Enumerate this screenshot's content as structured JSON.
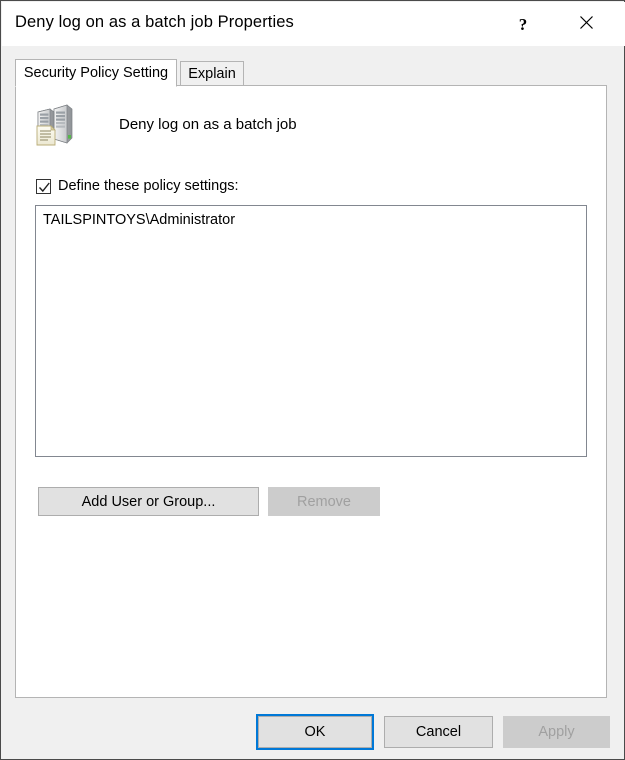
{
  "window": {
    "title": "Deny log on as a batch job Properties",
    "help_label": "?",
    "close_label": "✕"
  },
  "tabs": [
    {
      "label": "Security Policy Setting",
      "active": true
    },
    {
      "label": "Explain",
      "active": false
    }
  ],
  "content": {
    "policy_icon": "server-policy-icon",
    "policy_name": "Deny log on as a batch job",
    "define_checkbox": {
      "label": "Define these policy settings:",
      "checked": true
    },
    "list": {
      "items": [
        "TAILSPINTOYS\\Administrator"
      ]
    },
    "buttons": {
      "add": "Add User or Group...",
      "remove": "Remove",
      "remove_enabled": false
    }
  },
  "footer": {
    "ok": "OK",
    "cancel": "Cancel",
    "apply": "Apply",
    "apply_enabled": false
  },
  "colors": {
    "accent": "#0078d7",
    "dialog_bg": "#f0f0f0",
    "panel_bg": "#ffffff",
    "button_bg": "#e1e1e1",
    "button_border": "#adadad",
    "disabled_text": "#a0a0a0",
    "listbox_border": "#828790"
  }
}
